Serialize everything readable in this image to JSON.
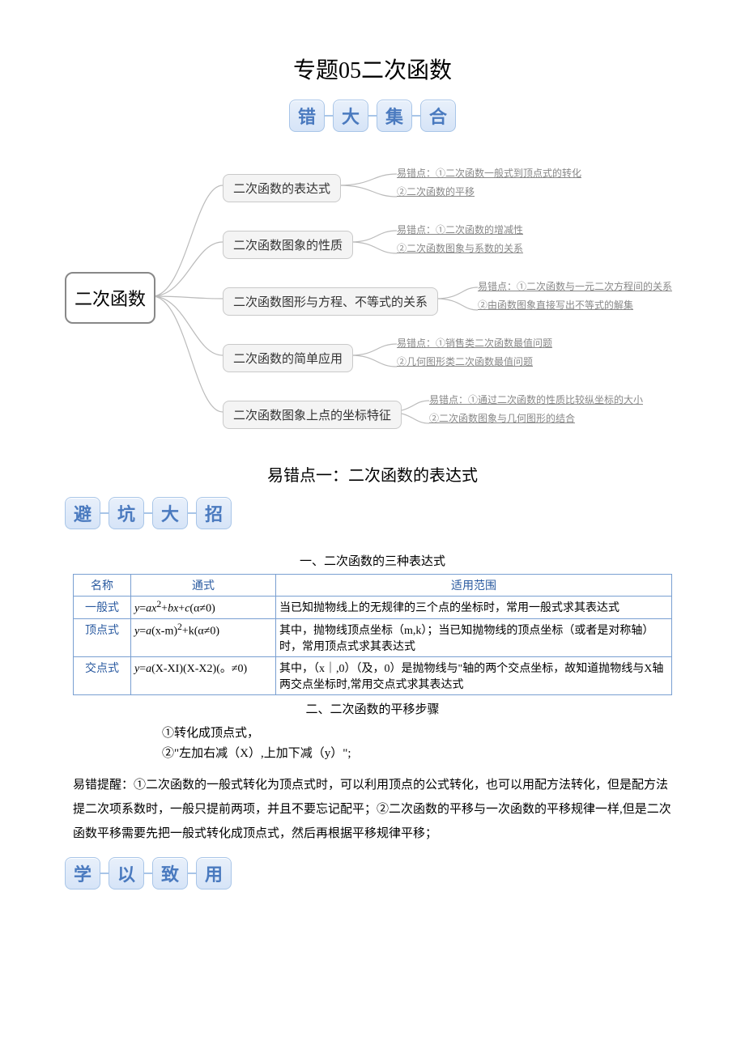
{
  "title": "专题05二次函数",
  "banner1": [
    "错",
    "大",
    "集",
    "合"
  ],
  "mindmap": {
    "root": "二次函数",
    "branches": [
      {
        "node": "二次函数的表达式",
        "leaves": [
          "易错点：①二次函数一般式到顶点式的转化",
          "②二次函数的平移"
        ]
      },
      {
        "node": "二次函数图象的性质",
        "leaves": [
          "易错点：①二次函数的增减性",
          "②二次函数图象与系数的关系"
        ]
      },
      {
        "node": "二次函数图形与方程、不等式的关系",
        "leaves": [
          "易错点：①二次函数与一元二次方程间的关系",
          "②由函数图象直接写出不等式的解集"
        ]
      },
      {
        "node": "二次函数的简单应用",
        "leaves": [
          "易错点：①销售类二次函数最值问题",
          "②几何图形类二次函数最值问题"
        ]
      },
      {
        "node": "二次函数图象上点的坐标特征",
        "leaves": [
          "易错点：①通过二次函数的性质比较纵坐标的大小",
          "②二次函数图象与几何图形的结合"
        ]
      }
    ]
  },
  "section1_title": "易错点一：二次函数的表达式",
  "banner2": [
    "避",
    "坑",
    "大",
    "招"
  ],
  "table_caption": "一、二次函数的三种表达式",
  "table": {
    "headers": [
      "名称",
      "通式",
      "适用范围"
    ],
    "rows": [
      {
        "name": "一般式",
        "formula_html": "<i>y</i>=<i>ax</i><sup>2</sup>+<i>bx</i>+<i>c</i>(α≠0)",
        "desc": "当已知抛物线上的无规律的三个点的坐标时，常用一般式求其表达式"
      },
      {
        "name": "顶点式",
        "formula_html": "<i>y</i>=<i>a</i>(x-m)<sup>2</sup>+k(α≠0)",
        "desc": "其中，抛物线顶点坐标（m,k）；当已知抛物线的顶点坐标（或者是对称轴）时，常用顶点式求其表达式"
      },
      {
        "name": "交点式",
        "formula_html": "<i>y</i>=<i>a</i>(X-XI)(X-X2)(。≠0)",
        "desc": "其中，（x｜,0）（及，0）是抛物线与\"轴的两个交点坐标，故知道抛物线与X轴两交点坐标时,常用交点式求其表达式"
      }
    ]
  },
  "sub2_title": "二、二次函数的平移步骤",
  "steps": [
    "①转化成顶点式，",
    "②\"左加右减（X）,上加下减（y）\";"
  ],
  "para": "易错提醒：①二次函数的一般式转化为顶点式时，可以利用顶点的公式转化，也可以用配方法转化，但是配方法提二次项系数时，一般只提前两项，并且不要忘记配平；②二次函数的平移与一次函数的平移规律一样,但是二次函数平移需要先把一般式转化成顶点式，然后再根据平移规律平移；",
  "banner3": [
    "学",
    "以",
    "致",
    "用"
  ]
}
